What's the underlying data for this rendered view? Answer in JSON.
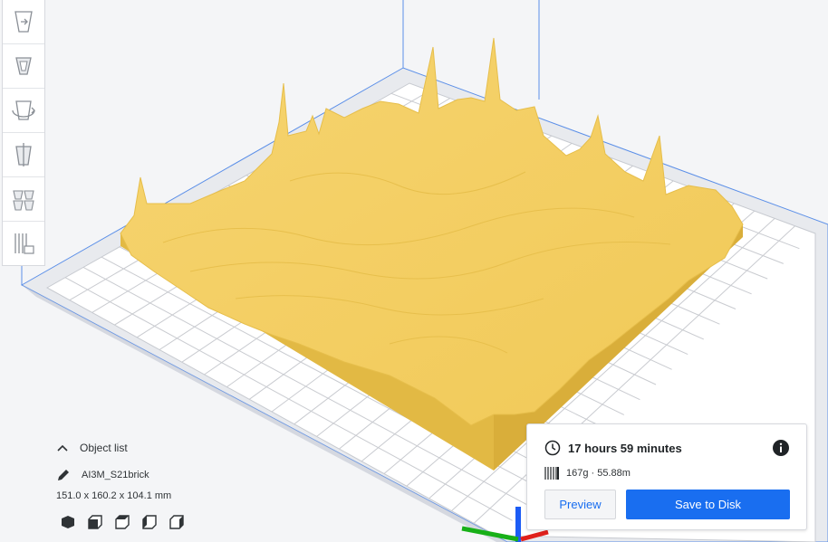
{
  "toolbar": {
    "tools": [
      {
        "name": "move-tool",
        "icon": "move-icon"
      },
      {
        "name": "scale-tool",
        "icon": "scale-icon"
      },
      {
        "name": "rotate-tool",
        "icon": "rotate-icon"
      },
      {
        "name": "mirror-tool",
        "icon": "mirror-icon"
      },
      {
        "name": "per-model-settings-tool",
        "icon": "per-model-settings-icon"
      },
      {
        "name": "support-blocker-tool",
        "icon": "support-blocker-icon"
      }
    ]
  },
  "object_list": {
    "header_label": "Object list",
    "object_name": "AI3M_S21brick",
    "dimensions": "151.0 x 160.2 x 104.1 mm",
    "view_icons": [
      "3d-view-icon",
      "front-view-icon",
      "top-view-icon",
      "left-view-icon",
      "right-view-icon"
    ]
  },
  "print_info": {
    "time": "17 hours 59 minutes",
    "material": "167g · 55.88m",
    "preview_label": "Preview",
    "save_label": "Save to Disk"
  },
  "colors": {
    "accent": "#196ef0",
    "model": "#f4cf60",
    "build_plate_grid": "#c9cbd0",
    "x_axis": "#e0201b",
    "y_axis": "#1c5cf5",
    "z_axis": "#18b018"
  }
}
